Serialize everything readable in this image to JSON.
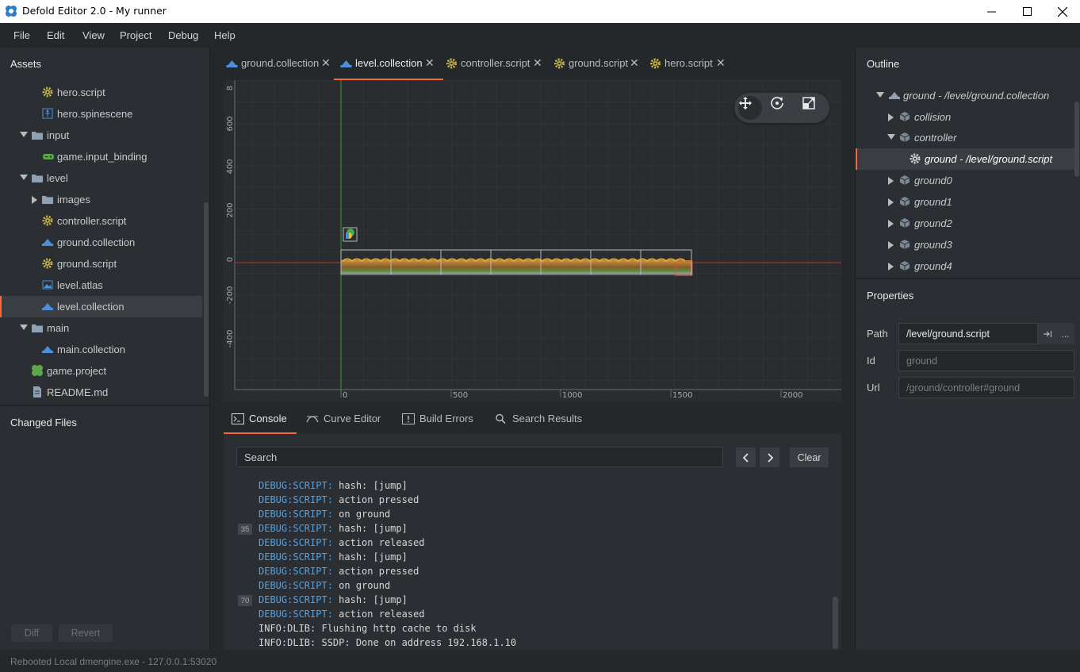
{
  "window": {
    "title": "Defold Editor 2.0 - My runner",
    "minimize_icon": "minimize-icon",
    "maximize_icon": "maximize-icon",
    "close_icon": "close-icon"
  },
  "menu": [
    "File",
    "Edit",
    "View",
    "Project",
    "Debug",
    "Help"
  ],
  "assets": {
    "title": "Assets",
    "items": [
      {
        "label": "hero.script",
        "icon": "script-gear-icon"
      },
      {
        "label": "hero.spinescene",
        "icon": "spine-icon"
      },
      {
        "label": "input",
        "icon": "folder-icon"
      },
      {
        "label": "game.input_binding",
        "icon": "gamepad-icon"
      },
      {
        "label": "level",
        "icon": "folder-icon"
      },
      {
        "label": "images",
        "icon": "folder-icon"
      },
      {
        "label": "controller.script",
        "icon": "script-gear-icon"
      },
      {
        "label": "ground.collection",
        "icon": "collection-icon"
      },
      {
        "label": "ground.script",
        "icon": "script-gear-icon"
      },
      {
        "label": "level.atlas",
        "icon": "atlas-icon"
      },
      {
        "label": "level.collection",
        "icon": "collection-icon"
      },
      {
        "label": "main",
        "icon": "folder-icon"
      },
      {
        "label": "main.collection",
        "icon": "collection-icon"
      },
      {
        "label": "game.project",
        "icon": "project-puzzle-icon"
      },
      {
        "label": "README.md",
        "icon": "document-icon"
      }
    ]
  },
  "changed_files": {
    "title": "Changed Files",
    "diff_label": "Diff",
    "revert_label": "Revert"
  },
  "tabs": [
    {
      "label": "ground.collection",
      "icon": "collection-icon"
    },
    {
      "label": "level.collection",
      "icon": "collection-icon"
    },
    {
      "label": "controller.script",
      "icon": "script-gear-icon"
    },
    {
      "label": "ground.script",
      "icon": "script-gear-icon"
    },
    {
      "label": "hero.script",
      "icon": "script-gear-icon"
    }
  ],
  "scene": {
    "x_ticks": [
      "0",
      "500",
      "1000",
      "1500",
      "2000"
    ],
    "y_ticks": [
      "8",
      "600",
      "400",
      "200",
      "0",
      "-200",
      "-400"
    ],
    "tools": [
      "move-icon",
      "rotate-icon",
      "scale-icon"
    ]
  },
  "console_tabs": [
    {
      "label": "Console",
      "icon": "terminal-icon"
    },
    {
      "label": "Curve Editor",
      "icon": "curve-icon"
    },
    {
      "label": "Build Errors",
      "icon": "error-icon"
    },
    {
      "label": "Search Results",
      "icon": "search-icon"
    }
  ],
  "console": {
    "search_placeholder": "Search",
    "clear_label": "Clear",
    "prev_icon": "chevron-left-icon",
    "next_icon": "chevron-right-icon",
    "badges": [
      "35",
      "70"
    ],
    "lines": [
      {
        "tag": "DEBUG:SCRIPT:",
        "msg": " hash: [jump]",
        "kind": "debug"
      },
      {
        "tag": "DEBUG:SCRIPT:",
        "msg": " action pressed",
        "kind": "debug"
      },
      {
        "tag": "DEBUG:SCRIPT:",
        "msg": " on ground",
        "kind": "debug"
      },
      {
        "tag": "DEBUG:SCRIPT:",
        "msg": " hash: [jump]",
        "kind": "debug"
      },
      {
        "tag": "DEBUG:SCRIPT:",
        "msg": " action released",
        "kind": "debug"
      },
      {
        "tag": "DEBUG:SCRIPT:",
        "msg": " hash: [jump]",
        "kind": "debug"
      },
      {
        "tag": "DEBUG:SCRIPT:",
        "msg": " action pressed",
        "kind": "debug"
      },
      {
        "tag": "DEBUG:SCRIPT:",
        "msg": " on ground",
        "kind": "debug"
      },
      {
        "tag": "DEBUG:SCRIPT:",
        "msg": " hash: [jump]",
        "kind": "debug"
      },
      {
        "tag": "DEBUG:SCRIPT:",
        "msg": " action released",
        "kind": "debug"
      },
      {
        "tag": "INFO:DLIB:",
        "msg": " Flushing http cache to disk",
        "kind": "info"
      },
      {
        "tag": "INFO:DLIB:",
        "msg": " SSDP: Done on address 192.168.1.10",
        "kind": "info"
      }
    ]
  },
  "outline": {
    "title": "Outline",
    "items": [
      {
        "label": "ground - /level/ground.collection",
        "icon": "collection-icon"
      },
      {
        "label": "collision",
        "icon": "game-object-cube-icon"
      },
      {
        "label": "controller",
        "icon": "game-object-cube-icon"
      },
      {
        "label": "ground - /level/ground.script",
        "icon": "script-gear-icon"
      },
      {
        "label": "ground0",
        "icon": "game-object-cube-icon"
      },
      {
        "label": "ground1",
        "icon": "game-object-cube-icon"
      },
      {
        "label": "ground2",
        "icon": "game-object-cube-icon"
      },
      {
        "label": "ground3",
        "icon": "game-object-cube-icon"
      },
      {
        "label": "ground4",
        "icon": "game-object-cube-icon"
      }
    ]
  },
  "properties": {
    "title": "Properties",
    "path_label": "Path",
    "path_value": "/level/ground.script",
    "id_label": "Id",
    "id_value": "ground",
    "url_label": "Url",
    "url_value": "/ground/controller#ground",
    "goto_icon": "goto-icon",
    "more_label": "..."
  },
  "status": {
    "text": "Rebooted Local dmengine.exe - 127.0.0.1:53020"
  },
  "colors": {
    "accent": "#ff6633",
    "debug_tag": "#4fa3e8",
    "script_icon": "#c8b44a",
    "collection_icon": "#4a8fd8"
  }
}
